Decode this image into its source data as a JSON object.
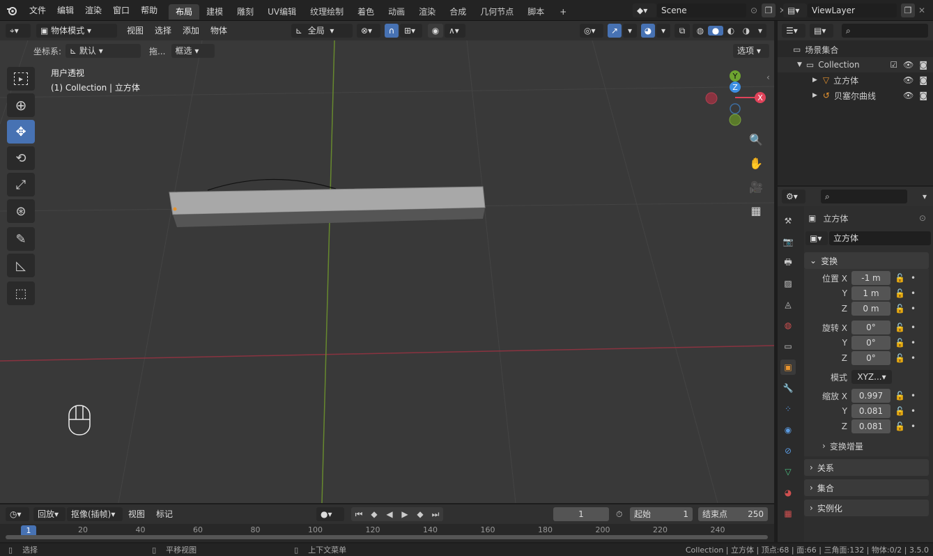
{
  "topbar": {
    "menus": [
      "文件",
      "编辑",
      "渲染",
      "窗口",
      "帮助"
    ],
    "workspaces": [
      "布局",
      "建模",
      "雕刻",
      "UV编辑",
      "纹理绘制",
      "着色",
      "动画",
      "渲染",
      "合成",
      "几何节点",
      "脚本"
    ],
    "add_tab": "+",
    "scene": "Scene",
    "view_layer": "ViewLayer"
  },
  "viewport_header": {
    "mode": "物体模式",
    "menus": [
      "视图",
      "选择",
      "添加",
      "物体"
    ],
    "transform_orient": "全局",
    "coord_label": "坐标系:",
    "coord_value": "默认",
    "drag_label": "拖...",
    "select_mode": "框选",
    "options": "选项"
  },
  "viewport": {
    "view_name": "用户透视",
    "object_info": "(1) Collection | 立方体",
    "gizmo_axes": [
      "X",
      "Y",
      "Z"
    ]
  },
  "outliner": {
    "root": "场景集合",
    "items": [
      {
        "label": "Collection"
      },
      {
        "label": "立方体"
      },
      {
        "label": "贝塞尔曲线"
      }
    ]
  },
  "properties": {
    "object_name": "立方体",
    "object_field": "立方体",
    "transform_header": "变换",
    "location_label": "位置 X",
    "loc": [
      "-1 m",
      "1 m",
      "0 m"
    ],
    "rotation_label": "旋转 X",
    "rot": [
      "0°",
      "0°",
      "0°"
    ],
    "mode_label": "模式",
    "mode_value": "XYZ...",
    "scale_label": "缩放 X",
    "scale": [
      "0.997",
      "0.081",
      "0.081"
    ],
    "axis_y": "Y",
    "axis_z": "Z",
    "delta": "变换增量",
    "sections": [
      "关系",
      "集合",
      "实例化"
    ]
  },
  "timeline": {
    "playback": "回放",
    "keying": "抠像(插帧)",
    "view": "视图",
    "marker": "标记",
    "current_frame": "1",
    "start_label": "起始",
    "start": "1",
    "end_label": "结束点",
    "end": "250",
    "ruler": [
      "1",
      "20",
      "40",
      "60",
      "80",
      "100",
      "120",
      "140",
      "160",
      "180",
      "200",
      "220",
      "240"
    ]
  },
  "status": {
    "select": "选择",
    "pan": "平移视图",
    "context": "上下文菜单",
    "info": "Collection | 立方体 | 顶点:68 | 面:66 | 三角面:132 | 物体:0/2 | 3.5.0"
  },
  "colors": {
    "accent": "#4772b3",
    "x_axis": "#e0435a",
    "y_axis": "#6ea430",
    "z_axis": "#3d8ee3",
    "object_orange": "#e8942e"
  }
}
